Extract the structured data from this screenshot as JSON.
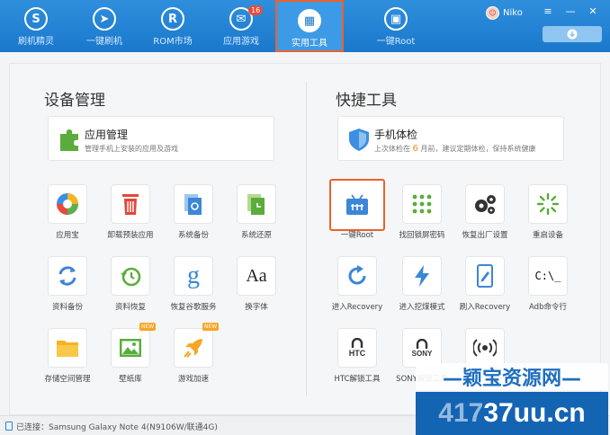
{
  "nav": {
    "items": [
      {
        "label": "刷机精灵",
        "glyph": "S"
      },
      {
        "label": "一键刷机",
        "glyph": "➤"
      },
      {
        "label": "ROM市场",
        "glyph": "R"
      },
      {
        "label": "应用游戏",
        "glyph": "✉",
        "badge": "16"
      },
      {
        "label": "实用工具",
        "glyph": "▦"
      },
      {
        "label": "一键Root",
        "glyph": "▣"
      }
    ],
    "active": "实用工具"
  },
  "user": {
    "name": "Niko"
  },
  "window_controls": {
    "menu": "≡",
    "minimize": "—",
    "close": "✕"
  },
  "download_icon": "download-icon",
  "device_management": {
    "title": "设备管理",
    "card": {
      "title": "应用管理",
      "desc": "管理手机上安装的应用及游戏"
    },
    "tools": [
      {
        "label": "应用宝"
      },
      {
        "label": "卸载预装应用"
      },
      {
        "label": "系统备份"
      },
      {
        "label": "系统还原"
      },
      {
        "label": "资料备份"
      },
      {
        "label": "资料恢复"
      },
      {
        "label": "恢复谷歌服务",
        "glyph": "g"
      },
      {
        "label": "换字体",
        "glyph": "Aa"
      },
      {
        "label": "存储空间管理"
      },
      {
        "label": "壁纸库",
        "tag": "NEW"
      },
      {
        "label": "游戏加速",
        "tag": "NEW"
      }
    ]
  },
  "quick_tools": {
    "title": "快捷工具",
    "card": {
      "title": "手机体检",
      "desc_prefix": "上次体检在",
      "desc_days": "6",
      "desc_suffix": "月前，建议定期体检，保持系统健康"
    },
    "tools": [
      {
        "label": "一键Root"
      },
      {
        "label": "找回锁屏密码"
      },
      {
        "label": "恢复出厂设置"
      },
      {
        "label": "重启设备"
      },
      {
        "label": "进入Recovery"
      },
      {
        "label": "进入挖煤模式"
      },
      {
        "label": "刷入Recovery"
      },
      {
        "label": "Adb命令行",
        "glyph": "C:\\_"
      },
      {
        "label": "HTC解锁工具",
        "glyph": "HTC"
      },
      {
        "label": "SONY解锁工具",
        "glyph": "SONY"
      },
      {
        "label": "",
        "glyph": ""
      }
    ]
  },
  "status": {
    "text": "已连接：Samsung Galaxy Note 4(N9106W/联通4G)"
  },
  "watermark": {
    "top": "—颖宝资源网—",
    "bottom_a": "417",
    "bottom_b": "37uu.cn"
  },
  "colors": {
    "top_bar": "#1a78cc",
    "highlight": "#e8632c",
    "accent_orange": "#f08d1c"
  }
}
